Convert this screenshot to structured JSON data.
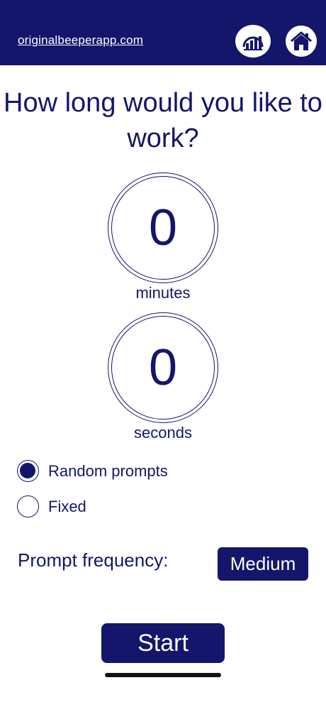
{
  "header": {
    "site_link": "originalbeeperapp.com",
    "stats_icon": "bar-chart-icon",
    "home_icon": "home-icon"
  },
  "title": "How long would you like to work?",
  "minutes": {
    "value": "0",
    "label": "minutes"
  },
  "seconds": {
    "value": "0",
    "label": "seconds"
  },
  "prompt_mode": {
    "options": [
      {
        "label": "Random prompts",
        "selected": true
      },
      {
        "label": "Fixed",
        "selected": false
      }
    ]
  },
  "frequency": {
    "label": "Prompt frequency:",
    "value": "Medium"
  },
  "start_label": "Start",
  "colors": {
    "brand": "#14166b",
    "background": "#ffffff"
  }
}
